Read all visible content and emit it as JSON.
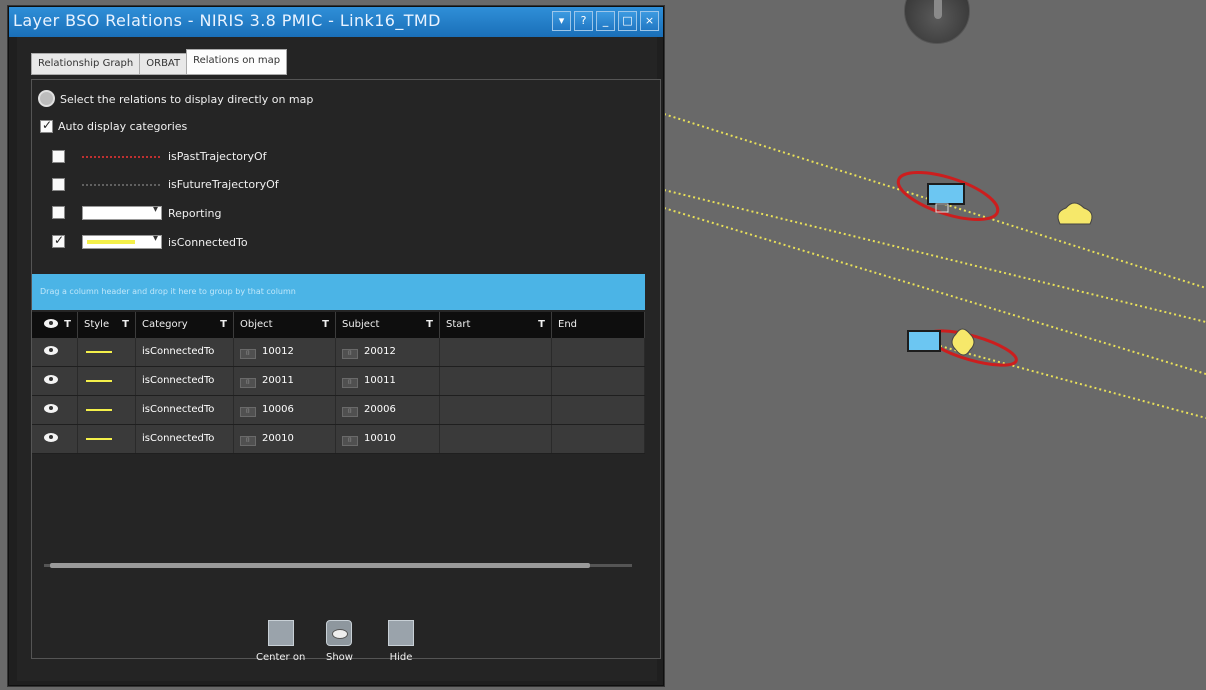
{
  "window": {
    "title": "Layer BSO Relations - NIRIS 3.8 PMIC - Link16_TMD",
    "buttons": [
      "▾",
      "?",
      "_",
      "□",
      "×"
    ]
  },
  "tabs": [
    {
      "label": "Relationship Graph",
      "active": false
    },
    {
      "label": "ORBAT",
      "active": false
    },
    {
      "label": "Relations on map",
      "active": true
    }
  ],
  "options": {
    "select_label": "Select the relations to display directly on map",
    "auto_display_label": "Auto display categories",
    "auto_display_checked": true
  },
  "categories": [
    {
      "label": "isPastTrajectoryOf",
      "checked": false,
      "style": "dotted-red"
    },
    {
      "label": "isFutureTrajectoryOf",
      "checked": false,
      "style": "dotted-grey"
    },
    {
      "label": "Reporting",
      "checked": false,
      "style": "dropdown-white"
    },
    {
      "label": "isConnectedTo",
      "checked": true,
      "style": "dropdown-yellow"
    }
  ],
  "group_bar_text": "Drag a column header and drop it here to group by that column",
  "grid": {
    "columns": [
      "",
      "Style",
      "Category",
      "Object",
      "Subject",
      "Start",
      "End"
    ],
    "rows": [
      {
        "category": "isConnectedTo",
        "object": "10012",
        "subject": "20012",
        "start": "",
        "end": ""
      },
      {
        "category": "isConnectedTo",
        "object": "20011",
        "subject": "10011",
        "start": "",
        "end": ""
      },
      {
        "category": "isConnectedTo",
        "object": "10006",
        "subject": "20006",
        "start": "",
        "end": ""
      },
      {
        "category": "isConnectedTo",
        "object": "20010",
        "subject": "10010",
        "start": "",
        "end": ""
      }
    ]
  },
  "actions": {
    "center_on": "Center on",
    "show": "Show",
    "hide": "Hide"
  },
  "colors": {
    "accent": "#4bb4e6",
    "title_bar": "#1f7cc7",
    "relation_line": "#f4f04a",
    "map_bg": "#696969",
    "selection_ellipse": "#d22020",
    "unit_blue": "#6cc6f2",
    "unit_yellow": "#f6e86a"
  }
}
